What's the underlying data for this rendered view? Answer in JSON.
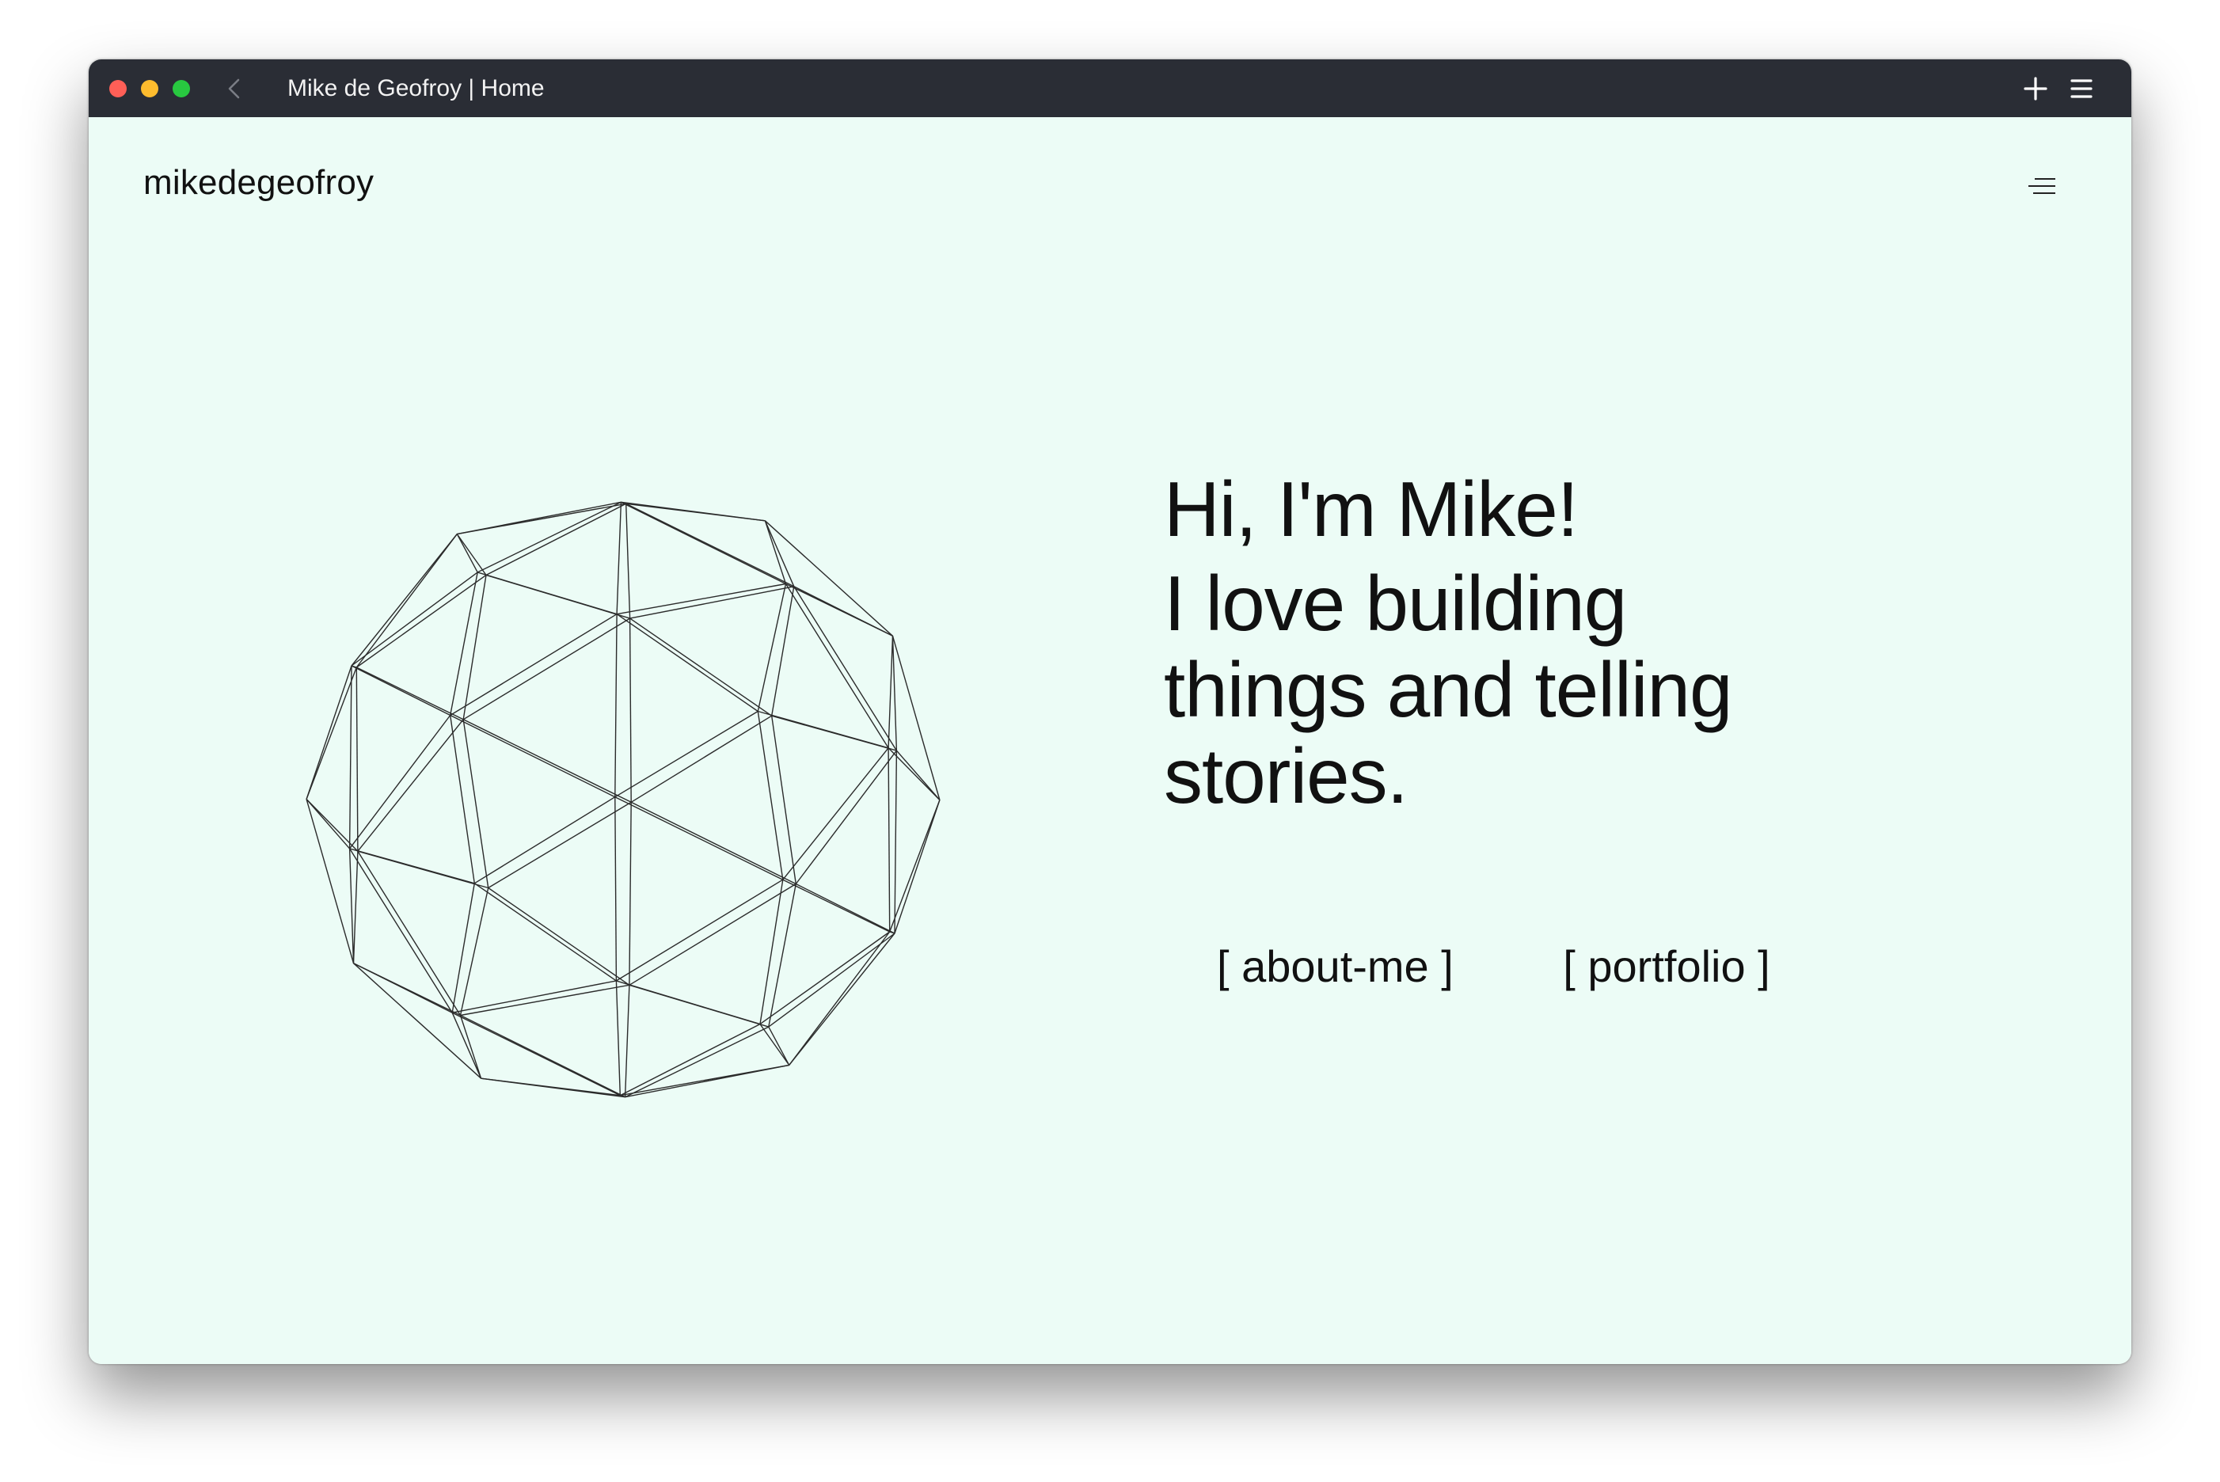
{
  "window": {
    "title": "Mike de Geofroy | Home",
    "controls": [
      "close",
      "minimize",
      "maximize"
    ],
    "icons": {
      "back": "chevron-left-icon",
      "new_tab": "plus-icon",
      "menu": "hamburger-menu-icon"
    }
  },
  "header": {
    "logo": "mikedegeofroy",
    "menu_icon": "menu-lines-icon"
  },
  "hero": {
    "greeting": "Hi, I'm Mike!",
    "tagline": "I love building things and telling stories.",
    "illustration": "wireframe-geodesic-sphere-icon"
  },
  "links": [
    {
      "label": "[ about-me ]"
    },
    {
      "label": "[ portfolio ]"
    }
  ],
  "colors": {
    "page_background": "#ecfcf6",
    "titlebar": "#2a2d35",
    "text": "#111111"
  }
}
